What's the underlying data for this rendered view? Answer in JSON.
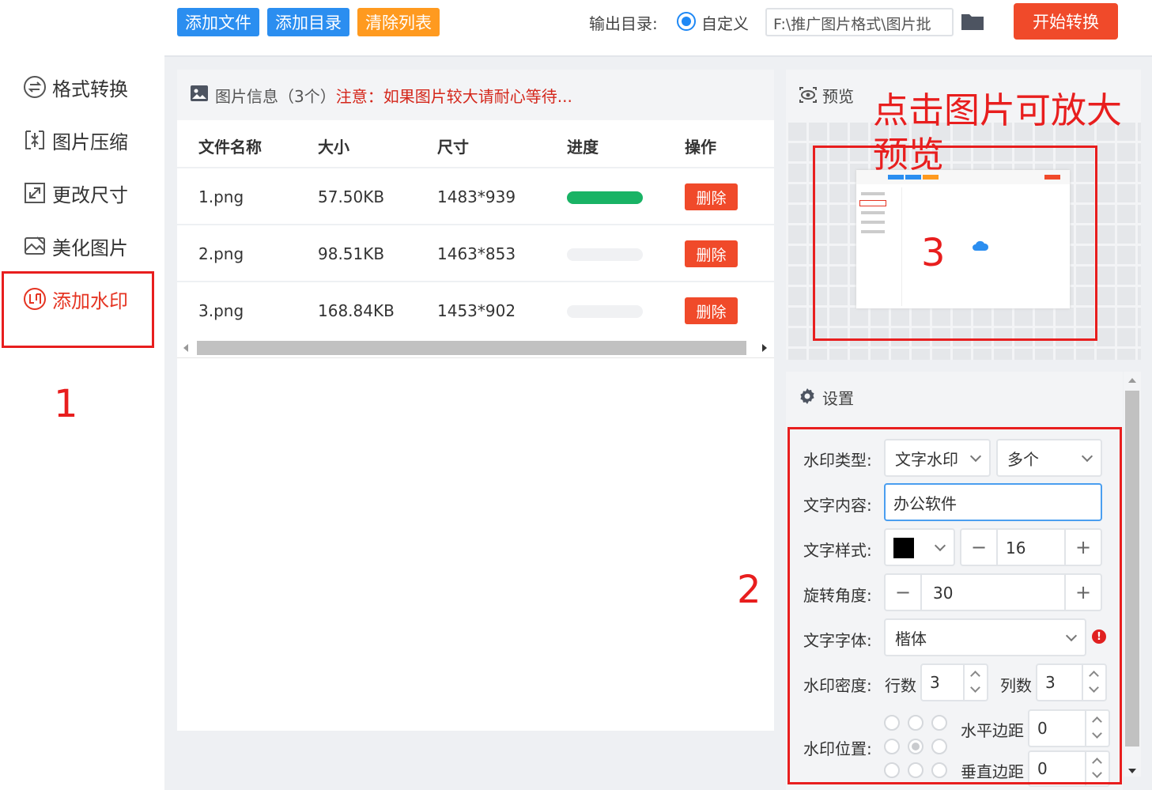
{
  "sidebar": {
    "items": [
      {
        "label": "格式转换",
        "icon": "format-convert-icon"
      },
      {
        "label": "图片压缩",
        "icon": "compress-icon"
      },
      {
        "label": "更改尺寸",
        "icon": "resize-icon"
      },
      {
        "label": "美化图片",
        "icon": "beautify-icon"
      },
      {
        "label": "添加水印",
        "icon": "watermark-icon",
        "active": true
      }
    ]
  },
  "toolbar": {
    "add_file": "添加文件",
    "add_dir": "添加目录",
    "clear_list": "清除列表",
    "output_label": "输出目录:",
    "output_option": "自定义",
    "output_path": "F:\\推广图片格式\\图片批",
    "start": "开始转换"
  },
  "file_panel": {
    "title": "图片信息（3个）",
    "notice": "注意：如果图片较大请耐心等待...",
    "columns": [
      "文件名称",
      "大小",
      "尺寸",
      "进度",
      "操作"
    ],
    "rows": [
      {
        "name": "1.png",
        "size": "57.50KB",
        "dims": "1483*939",
        "progress": 1.0,
        "action": "删除"
      },
      {
        "name": "2.png",
        "size": "98.51KB",
        "dims": "1463*853",
        "progress": 0,
        "action": "删除"
      },
      {
        "name": "3.png",
        "size": "168.84KB",
        "dims": "1453*902",
        "progress": 0,
        "action": "删除"
      }
    ]
  },
  "preview": {
    "title": "预览"
  },
  "settings": {
    "title": "设置",
    "watermark_type_label": "水印类型:",
    "watermark_type": "文字水印",
    "watermark_count": "多个",
    "text_content_label": "文字内容:",
    "text_content": "办公软件",
    "text_style_label": "文字样式:",
    "text_color": "#000000",
    "font_size": "16",
    "rotation_label": "旋转角度:",
    "rotation": "30",
    "font_label": "文字字体:",
    "font": "楷体",
    "density_label": "水印密度:",
    "rows_label": "行数",
    "rows": "3",
    "cols_label": "列数",
    "cols": "3",
    "position_label": "水印位置:",
    "position_selected": "center",
    "h_margin_label": "水平边距",
    "h_margin": "0",
    "v_margin_label": "垂直边距",
    "v_margin": "0"
  },
  "annotations": {
    "one": "1",
    "two": "2",
    "three": "3",
    "preview_hint": "点击图片可放大预览"
  },
  "colors": {
    "blue_btn": "#2b8ef0",
    "orange_btn": "#ff9a1f",
    "red_btn": "#f04a2a",
    "accent_red": "#e53422",
    "progress_green": "#19b365"
  }
}
